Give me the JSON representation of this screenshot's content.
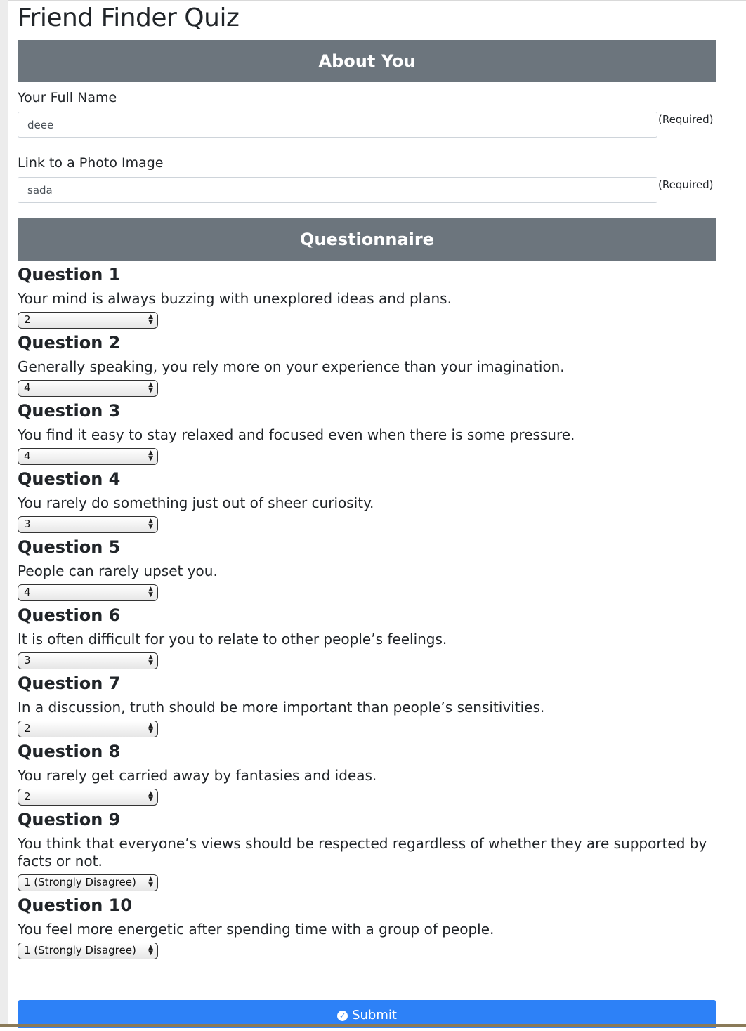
{
  "page": {
    "title": "Friend Finder Quiz"
  },
  "about": {
    "header": "About You",
    "name_label": "Your Full Name",
    "name_value": "deee",
    "photo_label": "Link to a Photo Image",
    "photo_value": "sada",
    "required_text": "(Required)"
  },
  "questionnaire": {
    "header": "Questionnaire",
    "questions": [
      {
        "title": "Question 1",
        "text": "Your mind is always buzzing with unexplored ideas and plans.",
        "selected": "2"
      },
      {
        "title": "Question 2",
        "text": "Generally speaking, you rely more on your experience than your imagination.",
        "selected": "4"
      },
      {
        "title": "Question 3",
        "text": "You find it easy to stay relaxed and focused even when there is some pressure.",
        "selected": "4"
      },
      {
        "title": "Question 4",
        "text": "You rarely do something just out of sheer curiosity.",
        "selected": "3"
      },
      {
        "title": "Question 5",
        "text": "People can rarely upset you.",
        "selected": "4"
      },
      {
        "title": "Question 6",
        "text": "It is often difficult for you to relate to other people’s feelings.",
        "selected": "3"
      },
      {
        "title": "Question 7",
        "text": "In a discussion, truth should be more important than people’s sensitivities.",
        "selected": "2"
      },
      {
        "title": "Question 8",
        "text": "You rarely get carried away by fantasies and ideas.",
        "selected": "2"
      },
      {
        "title": "Question 9",
        "text": "You think that everyone’s views should be respected regardless of whether they are supported by facts or not.",
        "selected": "1 (Strongly Disagree)"
      },
      {
        "title": "Question 10",
        "text": "You feel more energetic after spending time with a group of people.",
        "selected": "1 (Strongly Disagree)"
      }
    ]
  },
  "submit": {
    "label": "Submit",
    "icon": "check-circle-icon"
  },
  "colors": {
    "section_header": "#6c757d",
    "submit_button": "#2d81f7"
  }
}
